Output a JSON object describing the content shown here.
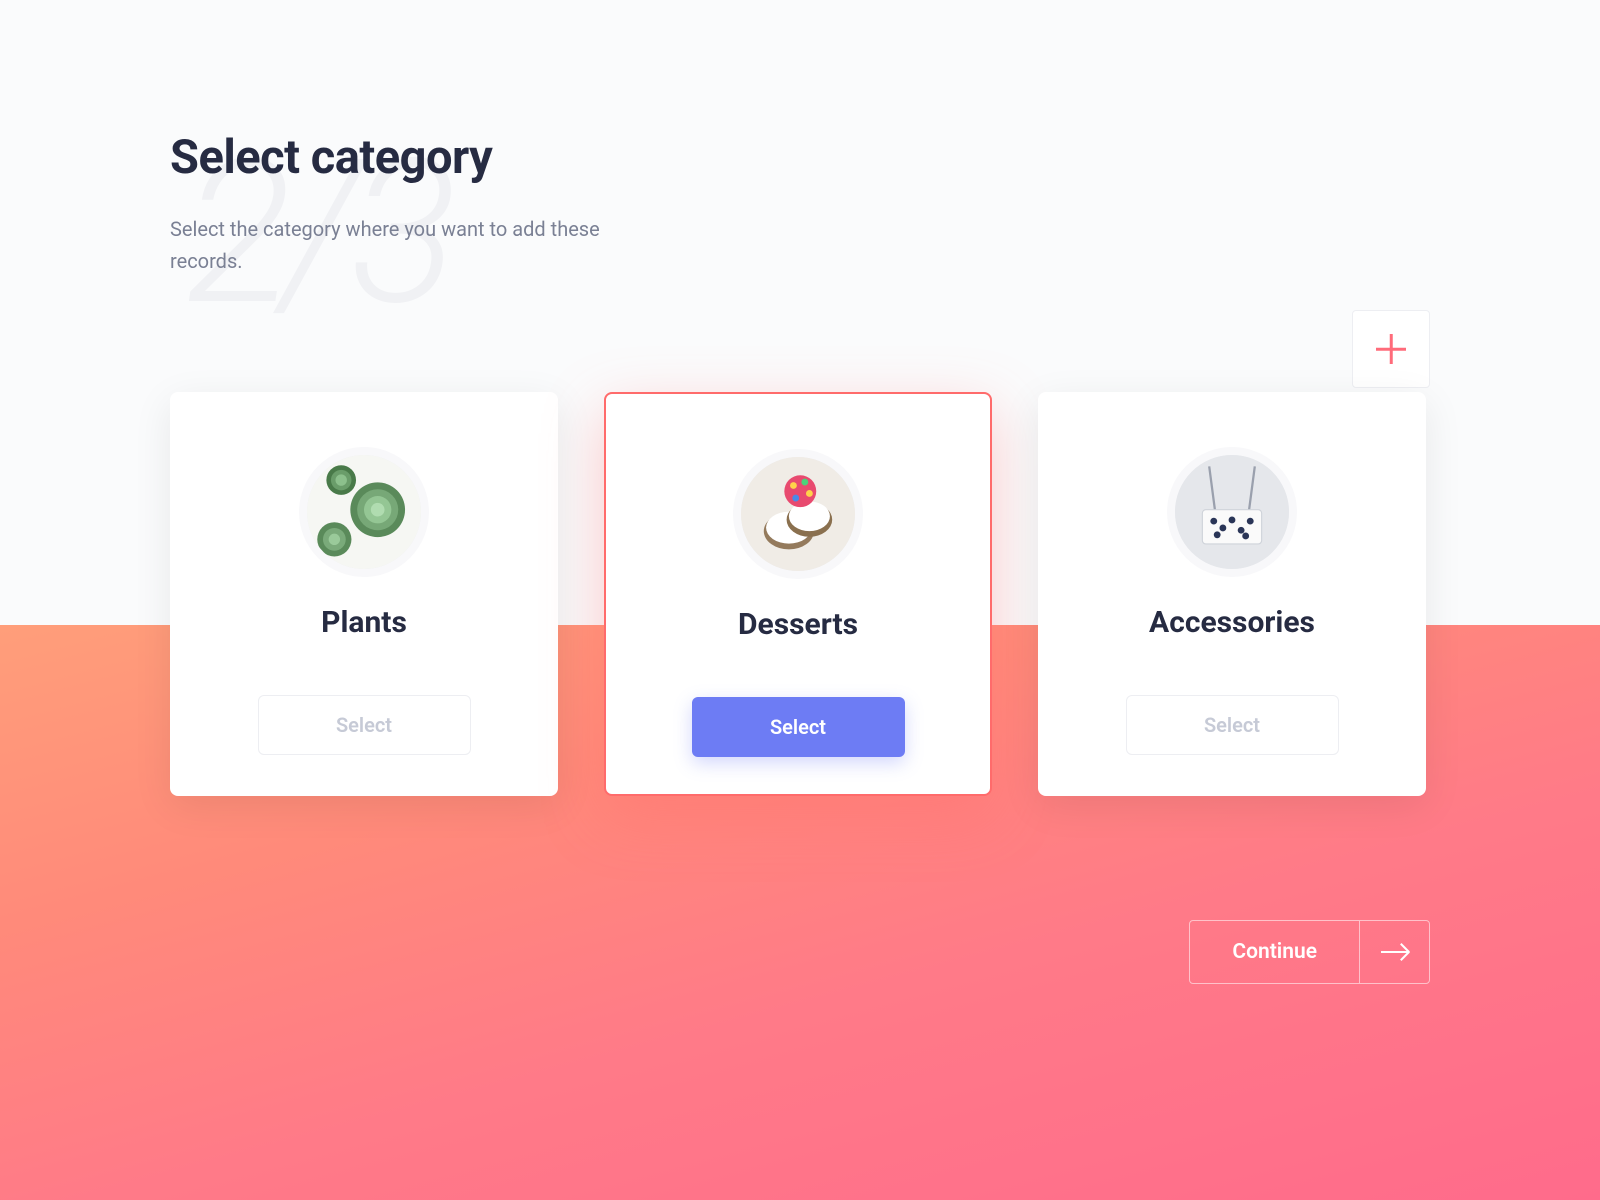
{
  "step_indicator": "2/3",
  "header": {
    "title": "Select category",
    "subtitle": "Select the category where you want to add these records."
  },
  "categories": [
    {
      "name": "Plants",
      "button_label": "Select",
      "selected": false
    },
    {
      "name": "Desserts",
      "button_label": "Select",
      "selected": true
    },
    {
      "name": "Accessories",
      "button_label": "Select",
      "selected": false
    }
  ],
  "continue_label": "Continue",
  "colors": {
    "accent": "#ff6b6b",
    "primary_button": "#6d7cf4",
    "text_dark": "#262b42",
    "text_muted": "#7a8094"
  }
}
